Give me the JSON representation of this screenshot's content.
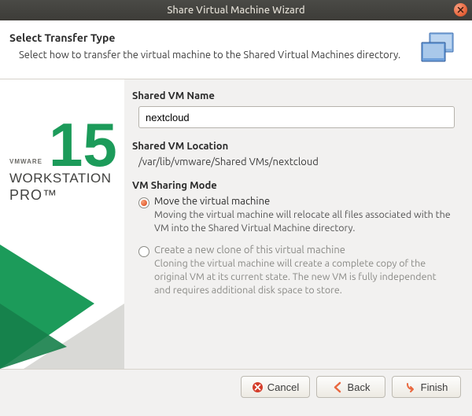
{
  "title": "Share Virtual Machine Wizard",
  "header": {
    "heading": "Select Transfer Type",
    "subtext": "Select how to transfer the virtual machine to the Shared Virtual Machines directory."
  },
  "sidebar": {
    "version": "15",
    "brand_small": "VMWARE",
    "brand_line1": "WORKSTATION",
    "brand_line2": "PRO™"
  },
  "form": {
    "name_label": "Shared VM Name",
    "name_value": "nextcloud",
    "location_label": "Shared VM Location",
    "location_value": "/var/lib/vmware/Shared VMs/nextcloud",
    "mode_label": "VM Sharing Mode",
    "options": [
      {
        "title": "Move the virtual machine",
        "desc": "Moving the virtual machine will relocate all files associated with the VM into the Shared Virtual Machine directory.",
        "checked": true
      },
      {
        "title": "Create a new clone of this virtual machine",
        "desc": "Cloning the virtual machine will create a complete copy of the original VM at its current state.  The new VM is fully independent and requires additional disk space to store.",
        "checked": false
      }
    ]
  },
  "buttons": {
    "cancel": "Cancel",
    "back": "Back",
    "finish": "Finish"
  }
}
